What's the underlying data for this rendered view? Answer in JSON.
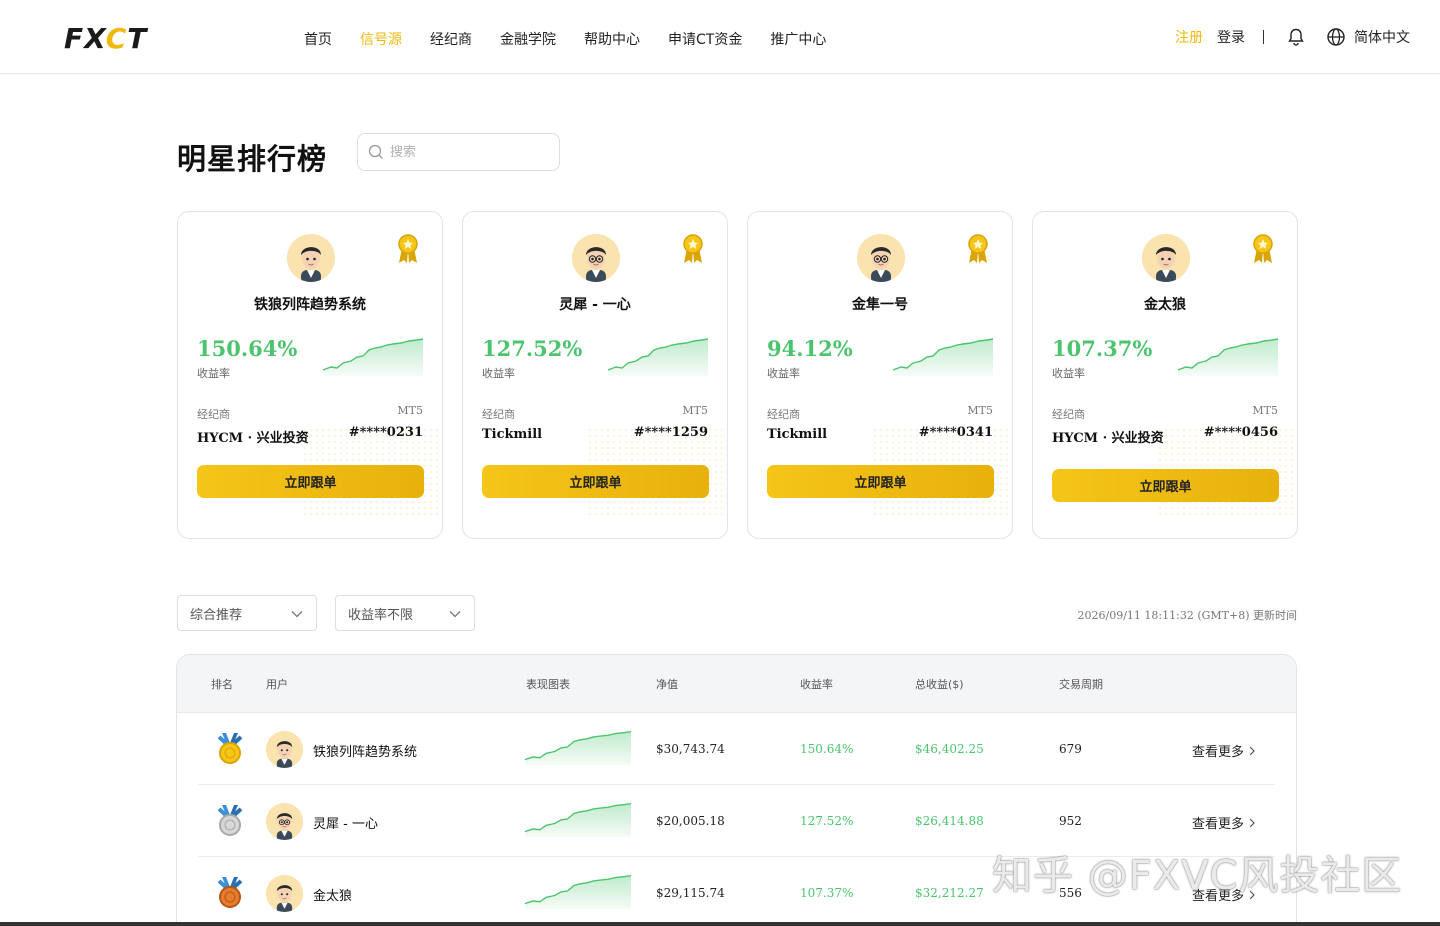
{
  "header": {
    "logo": "FXCT",
    "nav": [
      "首页",
      "信号源",
      "经纪商",
      "金融学院",
      "帮助中心",
      "申请CT资金",
      "推广中心"
    ],
    "active_nav": "信号源",
    "register": "注册",
    "login": "登录",
    "language": "简体中文",
    "accent_color": "#f0b90b"
  },
  "page": {
    "title": "明星排行榜",
    "search_placeholder": "搜索"
  },
  "cards": [
    {
      "name": "铁狼列阵趋势系统",
      "rate": "150.64%",
      "rate_label": "收益率",
      "broker_label": "经纪商",
      "platform": "MT5",
      "broker": "HYCM · 兴业投资",
      "account": "#****0231",
      "button": "立即跟单"
    },
    {
      "name": "灵犀 - 一心",
      "rate": "127.52%",
      "rate_label": "收益率",
      "broker_label": "经纪商",
      "platform": "MT5",
      "broker": "Tickmill",
      "account": "#****1259",
      "button": "立即跟单"
    },
    {
      "name": "金隼一号",
      "rate": "94.12%",
      "rate_label": "收益率",
      "broker_label": "经纪商",
      "platform": "MT5",
      "broker": "Tickmill",
      "account": "#****0341",
      "button": "立即跟单"
    },
    {
      "name": "金太狼",
      "rate": "107.37%",
      "rate_label": "收益率",
      "broker_label": "经纪商",
      "platform": "MT5",
      "broker": "HYCM · 兴业投资",
      "account": "#****0456",
      "button": "立即跟单"
    }
  ],
  "filters": {
    "sort": "综合推荐",
    "return_filter": "收益率不限",
    "update_time": "2026/09/11 18:11:32 (GMT+8) 更新时间"
  },
  "table": {
    "headers": [
      "排名",
      "用户",
      "表现图表",
      "净值",
      "收益率",
      "总收益($)",
      "交易周期"
    ],
    "rows": [
      {
        "medal": "gold",
        "name": "铁狼列阵趋势系统",
        "nav": "$30,743.74",
        "return": "150.64%",
        "profit": "$46,402.25",
        "period": "679",
        "action": "查看更多"
      },
      {
        "medal": "silver",
        "name": "灵犀 - 一心",
        "nav": "$20,005.18",
        "return": "127.52%",
        "profit": "$26,414.88",
        "period": "952",
        "action": "查看更多"
      },
      {
        "medal": "bronze",
        "name": "金太狼",
        "nav": "$29,115.74",
        "return": "107.37%",
        "profit": "$32,212.27",
        "period": "556",
        "action": "查看更多"
      }
    ]
  },
  "watermark": "知乎 @FXVC风投社区"
}
